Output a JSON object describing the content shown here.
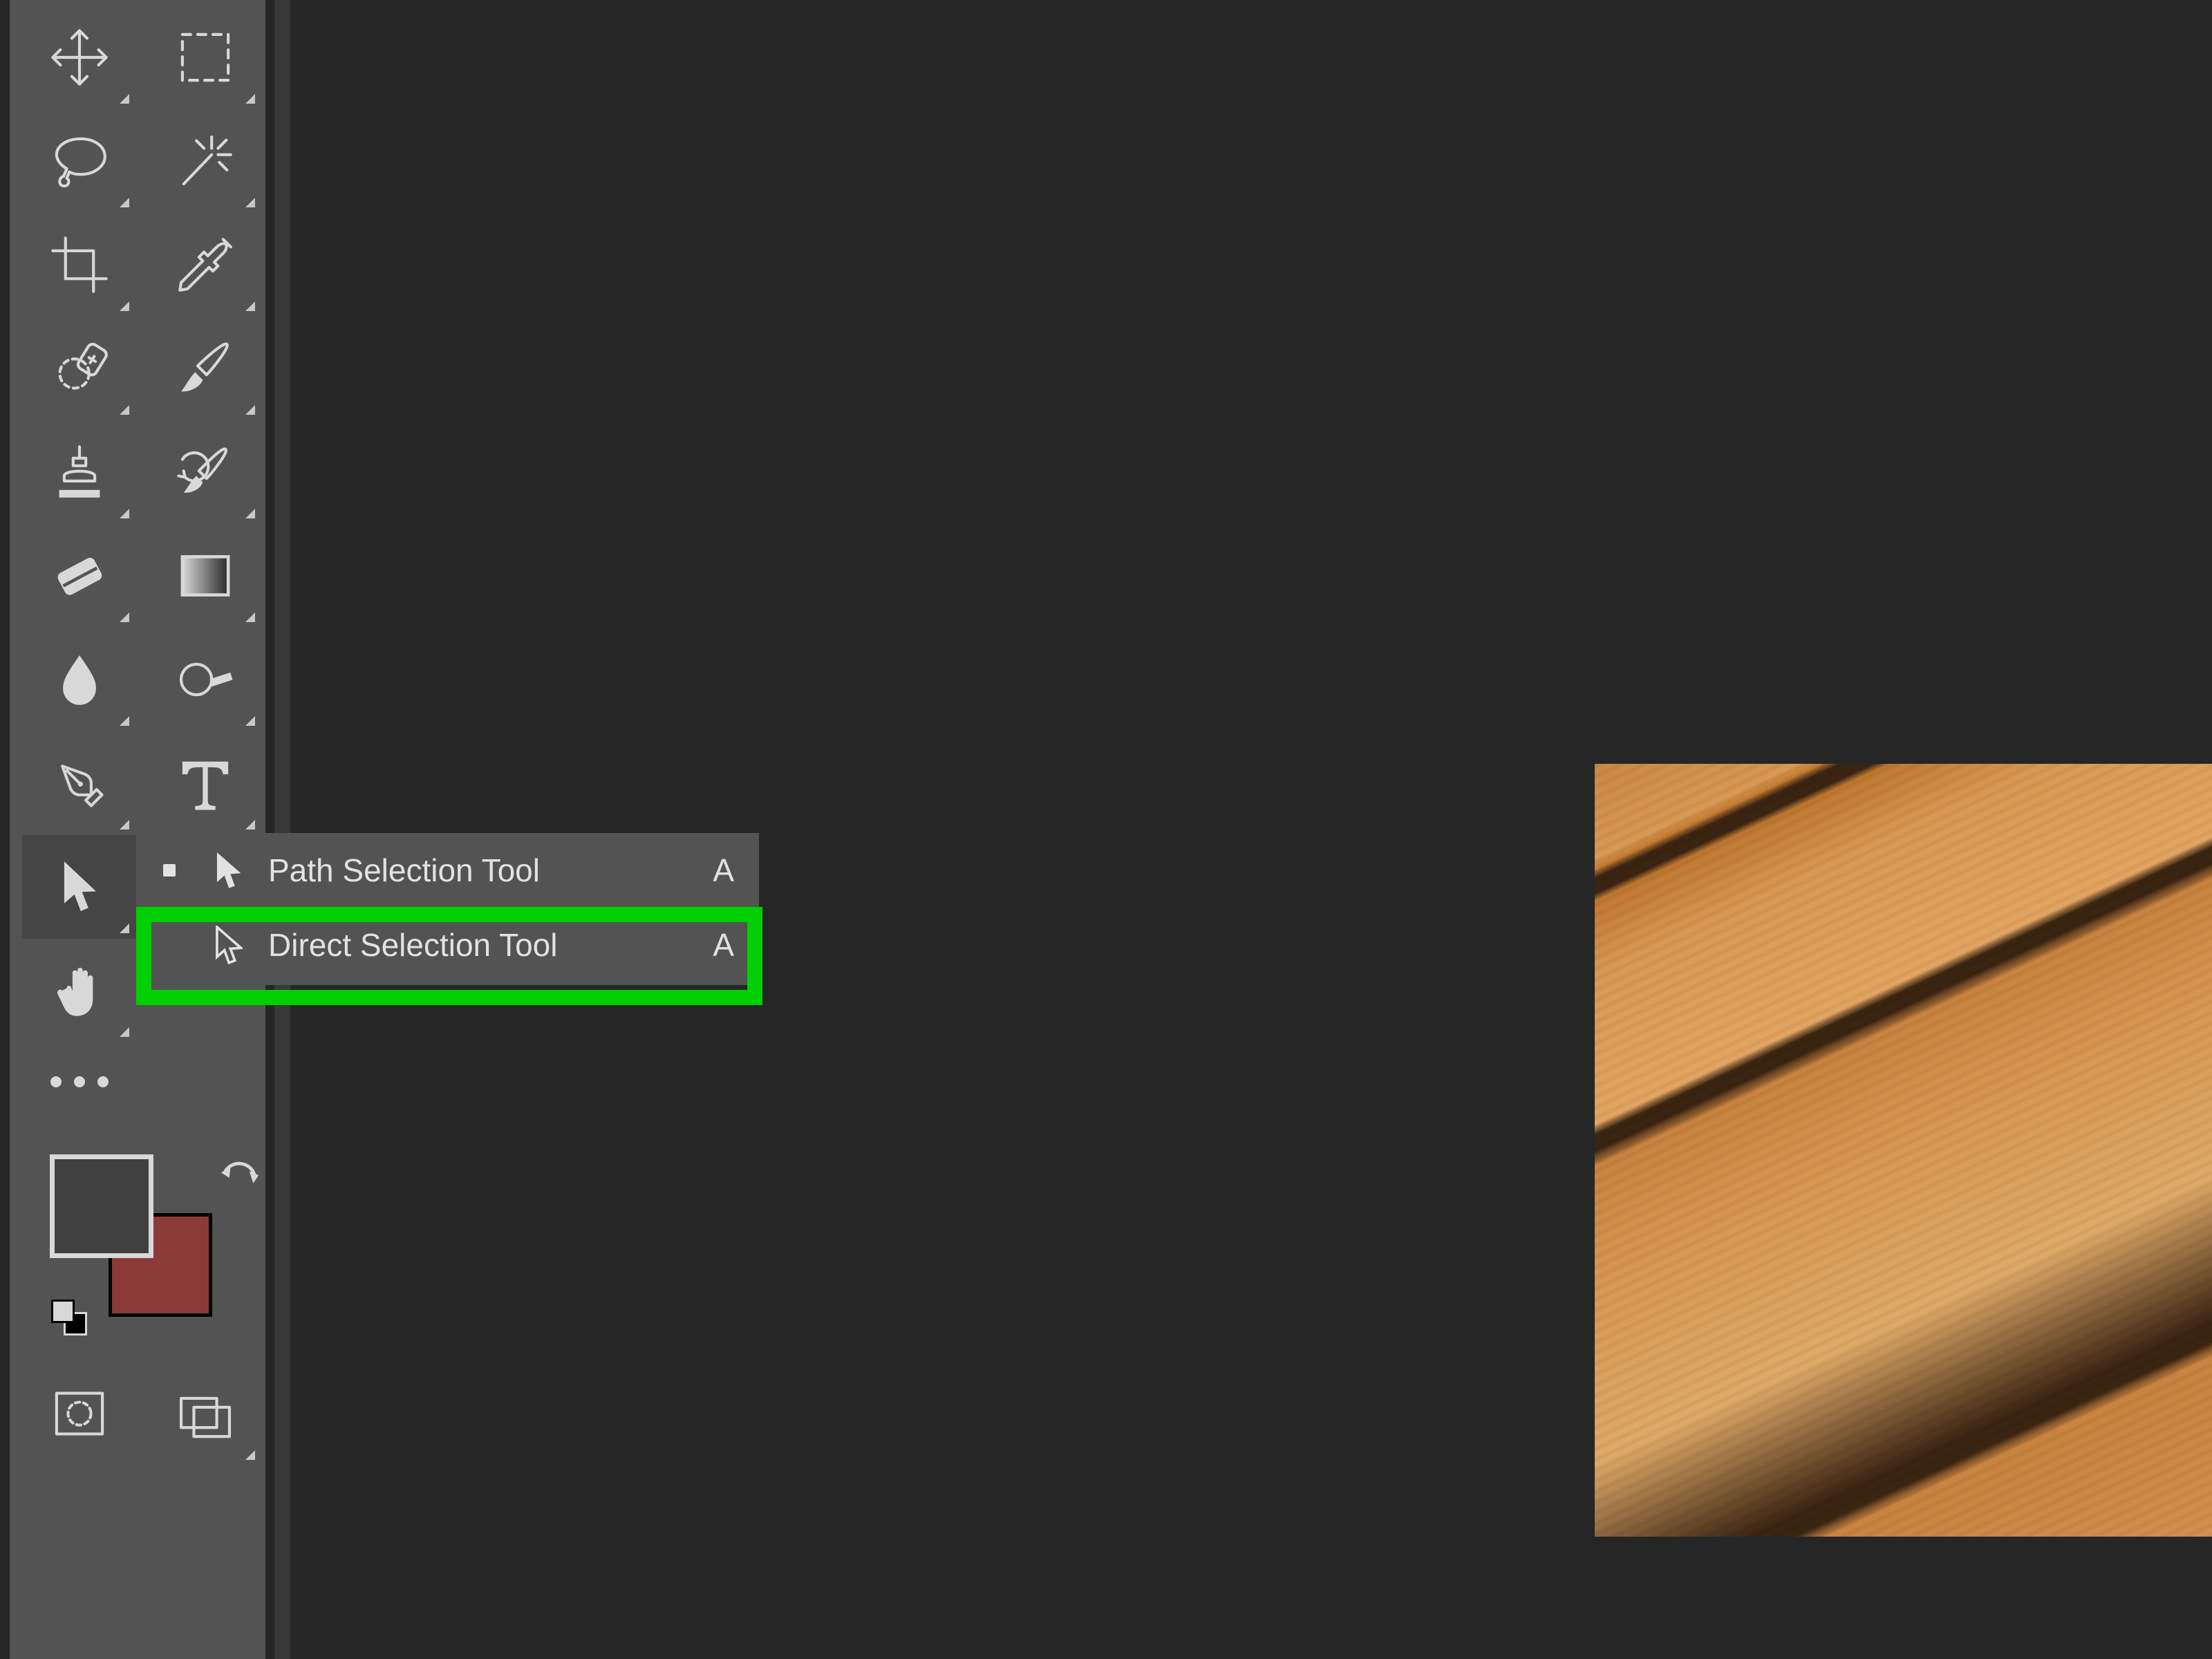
{
  "toolbar": {
    "tools": [
      {
        "id": "move",
        "icon": "move-icon",
        "has_sub": true
      },
      {
        "id": "marquee",
        "icon": "marquee-icon",
        "has_sub": true
      },
      {
        "id": "lasso",
        "icon": "lasso-icon",
        "has_sub": true
      },
      {
        "id": "wand",
        "icon": "magic-wand-icon",
        "has_sub": true
      },
      {
        "id": "crop",
        "icon": "crop-icon",
        "has_sub": true
      },
      {
        "id": "eyedropper",
        "icon": "eyedropper-icon",
        "has_sub": true
      },
      {
        "id": "healing",
        "icon": "healing-brush-icon",
        "has_sub": true
      },
      {
        "id": "brush",
        "icon": "brush-icon",
        "has_sub": true
      },
      {
        "id": "stamp",
        "icon": "clone-stamp-icon",
        "has_sub": true
      },
      {
        "id": "history",
        "icon": "history-brush-icon",
        "has_sub": true
      },
      {
        "id": "eraser",
        "icon": "eraser-icon",
        "has_sub": true
      },
      {
        "id": "gradient",
        "icon": "gradient-icon",
        "has_sub": true
      },
      {
        "id": "blur",
        "icon": "blur-icon",
        "has_sub": true
      },
      {
        "id": "dodge",
        "icon": "dodge-icon",
        "has_sub": true
      },
      {
        "id": "pen",
        "icon": "pen-icon",
        "has_sub": true
      },
      {
        "id": "type",
        "icon": "type-icon",
        "has_sub": true
      },
      {
        "id": "path",
        "icon": "path-selection-icon",
        "has_sub": true,
        "active": true
      },
      {
        "id": "hand",
        "icon": "hand-icon",
        "has_sub": true
      },
      {
        "id": "more",
        "icon": "ellipsis-icon",
        "has_sub": false
      }
    ]
  },
  "colors": {
    "foreground": "#404040",
    "background": "#8c3a37"
  },
  "flyout": {
    "items": [
      {
        "label": "Path Selection Tool",
        "shortcut": "A",
        "selected": true,
        "icon": "black-arrow-icon"
      },
      {
        "label": "Direct Selection Tool",
        "shortcut": "A",
        "selected": false,
        "icon": "white-arrow-icon"
      }
    ]
  },
  "annotation": {
    "highlighted_item_index": 1
  },
  "bottom_buttons": {
    "left": "quick-mask-icon",
    "right": "screen-mode-icon"
  }
}
